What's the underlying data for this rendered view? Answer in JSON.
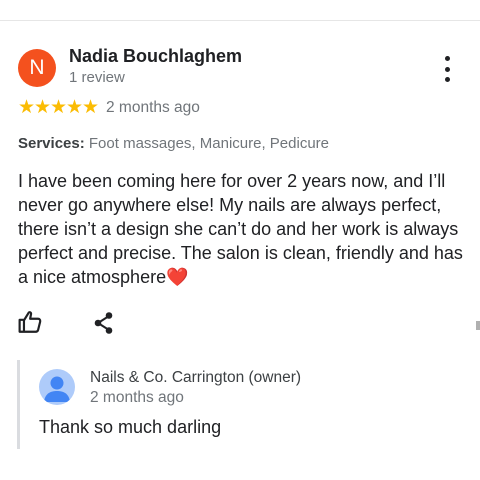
{
  "review": {
    "reviewer_initial": "N",
    "reviewer_name": "Nadia Bouchlaghem",
    "review_count": "1 review",
    "rating": 5,
    "date": "2 months ago",
    "services_label": "Services:",
    "services_value": "Foot massages, Manicure, Pedicure",
    "text": "I have been coming here for over 2 years now, and I’ll never go anywhere else! My nails are always perfect, there isn’t a design she can’t do and her work is always perfect and precise. The salon is clean, friendly and has a nice atmosphere",
    "text_emoji": "❤️"
  },
  "actions": {
    "like_icon": "thumbs-up-icon",
    "share_icon": "share-icon",
    "more_icon": "more-vert-icon"
  },
  "reply": {
    "owner_name": "Nails & Co. Carrington (owner)",
    "date": "2 months ago",
    "text": "Thank so much darling"
  },
  "colors": {
    "avatar": "#f4511e",
    "star": "#fbbc04",
    "owner_avatar_bg": "#aecbfa",
    "owner_avatar_fg": "#4285f4",
    "secondary_text": "#70757a"
  }
}
